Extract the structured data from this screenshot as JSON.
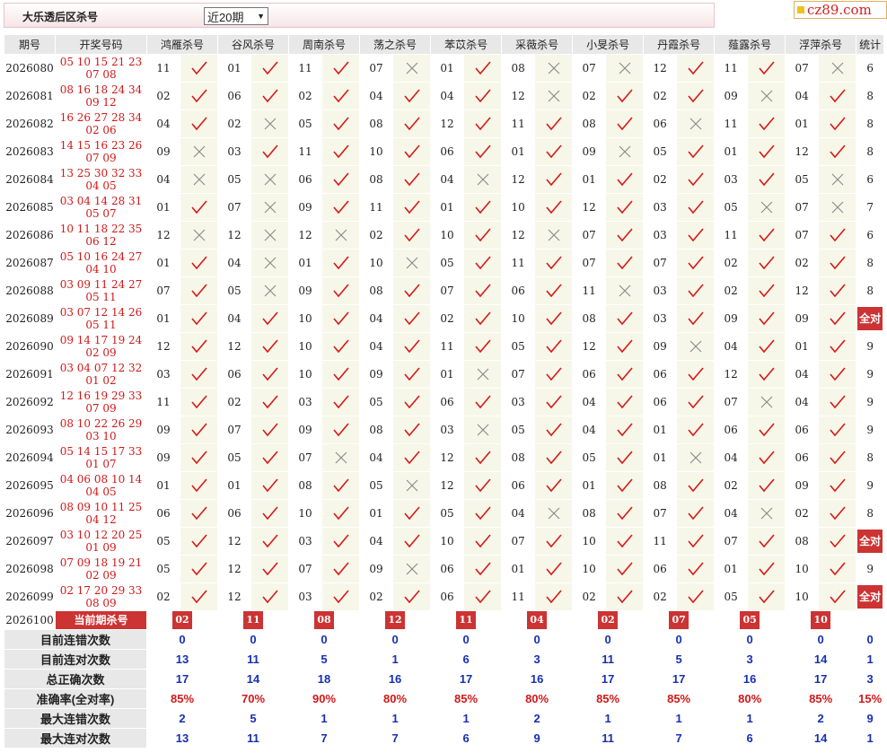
{
  "header": {
    "title": "大乐透后区杀号",
    "period_select": "近20期",
    "logo": "cz89.com"
  },
  "columns": {
    "issue": "期号",
    "draw": "开奖号码",
    "stat": "统计"
  },
  "experts": [
    "鸿雁杀号",
    "谷风杀号",
    "周南杀号",
    "荡之杀号",
    "苯苡杀号",
    "采薇杀号",
    "小旻杀号",
    "丹霞杀号",
    "薤露杀号",
    "浮萍杀号"
  ],
  "rows": [
    {
      "issue": "2026080",
      "draw": "05 10 15 21 23 07 08",
      "picks": [
        "11",
        "01",
        "11",
        "07",
        "01",
        "08",
        "07",
        "12",
        "11",
        "07"
      ],
      "hits": [
        1,
        1,
        1,
        0,
        1,
        0,
        0,
        1,
        1,
        0
      ],
      "stat": "6"
    },
    {
      "issue": "2026081",
      "draw": "08 16 18 24 34 09 12",
      "picks": [
        "02",
        "06",
        "02",
        "04",
        "04",
        "12",
        "02",
        "02",
        "09",
        "04"
      ],
      "hits": [
        1,
        1,
        1,
        1,
        1,
        0,
        1,
        1,
        0,
        1
      ],
      "stat": "8"
    },
    {
      "issue": "2026082",
      "draw": "16 26 27 28 34 02 06",
      "picks": [
        "04",
        "02",
        "05",
        "08",
        "12",
        "11",
        "08",
        "06",
        "11",
        "01"
      ],
      "hits": [
        1,
        0,
        1,
        1,
        1,
        1,
        1,
        0,
        1,
        1
      ],
      "stat": "8"
    },
    {
      "issue": "2026083",
      "draw": "14 15 16 23 26 07 09",
      "picks": [
        "09",
        "03",
        "11",
        "10",
        "06",
        "01",
        "09",
        "05",
        "01",
        "12"
      ],
      "hits": [
        0,
        1,
        1,
        1,
        1,
        1,
        0,
        1,
        1,
        1
      ],
      "stat": "8"
    },
    {
      "issue": "2026084",
      "draw": "13 25 30 32 33 04 05",
      "picks": [
        "04",
        "05",
        "06",
        "08",
        "04",
        "12",
        "01",
        "02",
        "03",
        "05"
      ],
      "hits": [
        0,
        0,
        1,
        1,
        0,
        1,
        1,
        1,
        1,
        0
      ],
      "stat": "6"
    },
    {
      "issue": "2026085",
      "draw": "03 04 14 28 31 05 07",
      "picks": [
        "01",
        "07",
        "09",
        "11",
        "01",
        "10",
        "12",
        "03",
        "05",
        "07"
      ],
      "hits": [
        1,
        0,
        1,
        1,
        1,
        1,
        1,
        1,
        0,
        0
      ],
      "stat": "7"
    },
    {
      "issue": "2026086",
      "draw": "10 11 18 22 35 06 12",
      "picks": [
        "12",
        "12",
        "12",
        "02",
        "10",
        "12",
        "07",
        "03",
        "11",
        "07"
      ],
      "hits": [
        0,
        0,
        0,
        1,
        1,
        0,
        1,
        1,
        1,
        1
      ],
      "stat": "6"
    },
    {
      "issue": "2026087",
      "draw": "05 10 16 24 27 04 10",
      "picks": [
        "01",
        "04",
        "01",
        "10",
        "05",
        "11",
        "07",
        "07",
        "02",
        "02"
      ],
      "hits": [
        1,
        0,
        1,
        0,
        1,
        1,
        1,
        1,
        1,
        1
      ],
      "stat": "8"
    },
    {
      "issue": "2026088",
      "draw": "03 09 11 24 27 05 11",
      "picks": [
        "07",
        "05",
        "09",
        "08",
        "07",
        "06",
        "11",
        "03",
        "02",
        "12"
      ],
      "hits": [
        1,
        0,
        1,
        1,
        1,
        1,
        0,
        1,
        1,
        1
      ],
      "stat": "8"
    },
    {
      "issue": "2026089",
      "draw": "03 07 12 14 26 05 11",
      "picks": [
        "01",
        "04",
        "10",
        "04",
        "02",
        "10",
        "08",
        "03",
        "09",
        "09"
      ],
      "hits": [
        1,
        1,
        1,
        1,
        1,
        1,
        1,
        1,
        1,
        1
      ],
      "stat": "全对"
    },
    {
      "issue": "2026090",
      "draw": "09 14 17 19 24 02 09",
      "picks": [
        "12",
        "12",
        "10",
        "04",
        "11",
        "05",
        "12",
        "09",
        "04",
        "01"
      ],
      "hits": [
        1,
        1,
        1,
        1,
        1,
        1,
        1,
        0,
        1,
        1
      ],
      "stat": "9"
    },
    {
      "issue": "2026091",
      "draw": "03 04 07 12 32 01 02",
      "picks": [
        "03",
        "06",
        "10",
        "09",
        "01",
        "07",
        "06",
        "06",
        "12",
        "04"
      ],
      "hits": [
        1,
        1,
        1,
        1,
        0,
        1,
        1,
        1,
        1,
        1
      ],
      "stat": "9"
    },
    {
      "issue": "2026092",
      "draw": "12 16 19 29 33 07 09",
      "picks": [
        "11",
        "02",
        "03",
        "05",
        "06",
        "03",
        "04",
        "06",
        "07",
        "04"
      ],
      "hits": [
        1,
        1,
        1,
        1,
        1,
        1,
        1,
        1,
        0,
        1
      ],
      "stat": "9"
    },
    {
      "issue": "2026093",
      "draw": "08 10 22 26 29 03 10",
      "picks": [
        "09",
        "07",
        "09",
        "08",
        "03",
        "05",
        "04",
        "01",
        "06",
        "06"
      ],
      "hits": [
        1,
        1,
        1,
        1,
        0,
        1,
        1,
        1,
        1,
        1
      ],
      "stat": "9"
    },
    {
      "issue": "2026094",
      "draw": "05 14 15 17 33 01 07",
      "picks": [
        "09",
        "05",
        "07",
        "04",
        "12",
        "08",
        "05",
        "01",
        "04",
        "06"
      ],
      "hits": [
        1,
        1,
        0,
        1,
        1,
        1,
        1,
        0,
        1,
        1
      ],
      "stat": "8"
    },
    {
      "issue": "2026095",
      "draw": "04 06 08 10 14 04 05",
      "picks": [
        "01",
        "01",
        "08",
        "05",
        "12",
        "06",
        "01",
        "08",
        "02",
        "09"
      ],
      "hits": [
        1,
        1,
        1,
        0,
        1,
        1,
        1,
        1,
        1,
        1
      ],
      "stat": "9"
    },
    {
      "issue": "2026096",
      "draw": "08 09 10 11 25 04 12",
      "picks": [
        "06",
        "06",
        "10",
        "01",
        "05",
        "04",
        "08",
        "07",
        "04",
        "02"
      ],
      "hits": [
        1,
        1,
        1,
        1,
        1,
        0,
        1,
        1,
        0,
        1
      ],
      "stat": "8"
    },
    {
      "issue": "2026097",
      "draw": "03 10 12 20 25 01 09",
      "picks": [
        "05",
        "12",
        "03",
        "04",
        "10",
        "07",
        "10",
        "11",
        "07",
        "08"
      ],
      "hits": [
        1,
        1,
        1,
        1,
        1,
        1,
        1,
        1,
        1,
        1
      ],
      "stat": "全对"
    },
    {
      "issue": "2026098",
      "draw": "07 09 18 19 21 02 09",
      "picks": [
        "05",
        "12",
        "07",
        "09",
        "06",
        "01",
        "10",
        "06",
        "01",
        "10"
      ],
      "hits": [
        1,
        1,
        1,
        0,
        1,
        1,
        1,
        1,
        1,
        1
      ],
      "stat": "9"
    },
    {
      "issue": "2026099",
      "draw": "02 17 20 29 33 08 09",
      "picks": [
        "02",
        "12",
        "03",
        "02",
        "06",
        "11",
        "02",
        "02",
        "05",
        "10"
      ],
      "hits": [
        1,
        1,
        1,
        1,
        1,
        1,
        1,
        1,
        1,
        1
      ],
      "stat": "全对"
    }
  ],
  "current": {
    "issue": "2026100",
    "label": "当前期杀号",
    "picks": [
      "02",
      "11",
      "08",
      "12",
      "11",
      "04",
      "02",
      "07",
      "05",
      "10"
    ]
  },
  "summary": [
    {
      "label": "目前连错次数",
      "values": [
        "0",
        "0",
        "0",
        "0",
        "0",
        "0",
        "0",
        "0",
        "0",
        "0"
      ],
      "stat": "0",
      "color": "blue"
    },
    {
      "label": "目前连对次数",
      "values": [
        "13",
        "11",
        "5",
        "1",
        "6",
        "3",
        "11",
        "5",
        "3",
        "14"
      ],
      "stat": "1",
      "color": "blue"
    },
    {
      "label": "总正确次数",
      "values": [
        "17",
        "14",
        "18",
        "16",
        "17",
        "16",
        "17",
        "17",
        "16",
        "17"
      ],
      "stat": "3",
      "color": "blue"
    },
    {
      "label": "准确率(全对率)",
      "values": [
        "85%",
        "70%",
        "90%",
        "80%",
        "85%",
        "80%",
        "85%",
        "85%",
        "80%",
        "85%"
      ],
      "stat": "15%",
      "color": "red"
    },
    {
      "label": "最大连错次数",
      "values": [
        "2",
        "5",
        "1",
        "1",
        "1",
        "2",
        "1",
        "1",
        "1",
        "2"
      ],
      "stat": "9",
      "color": "blue"
    },
    {
      "label": "最大连对次数",
      "values": [
        "13",
        "11",
        "7",
        "7",
        "6",
        "9",
        "11",
        "7",
        "6",
        "14"
      ],
      "stat": "1",
      "color": "blue"
    }
  ]
}
